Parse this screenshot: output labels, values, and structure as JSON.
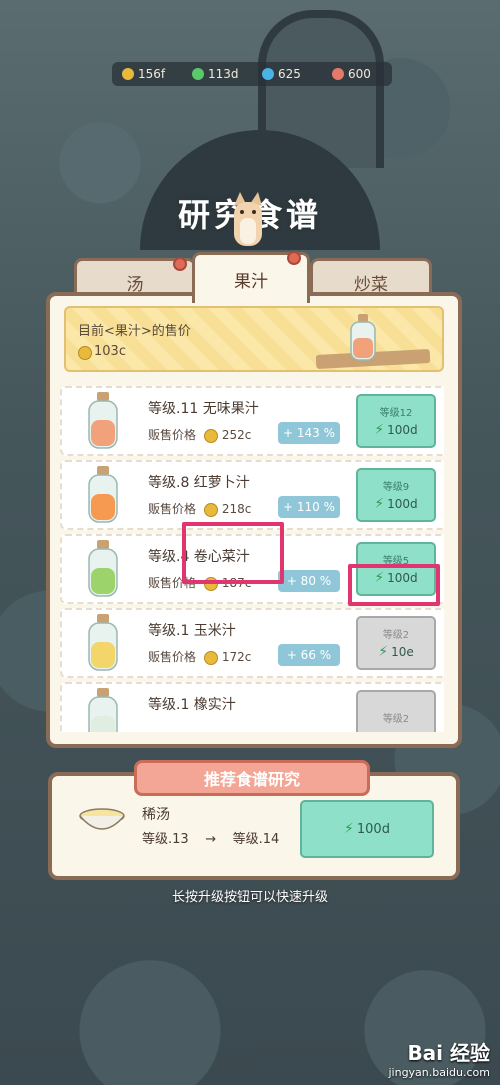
{
  "resources": [
    {
      "icon": "coin-icon",
      "value": "156f",
      "color": "#e8b93a"
    },
    {
      "icon": "energy-icon",
      "value": "113d",
      "color": "#5bc96a"
    },
    {
      "icon": "gem-icon",
      "value": "625",
      "color": "#4ab3e6"
    },
    {
      "icon": "heart-icon",
      "value": "600",
      "color": "#e67a6a"
    }
  ],
  "title": "研究食谱",
  "tabs": [
    {
      "label": "汤"
    },
    {
      "label": "果汁"
    },
    {
      "label": "炒菜"
    }
  ],
  "banner": {
    "label": "目前<果汁>的售价",
    "price": "103c"
  },
  "recipes": [
    {
      "name": "等级.11  无味果汁",
      "sell_label": "贩售价格",
      "sell": "252c",
      "pct": "+ 143 %",
      "next": "等级12",
      "cost": "100d",
      "juice": "#f2a27a",
      "locked": false
    },
    {
      "name": "等级.8  红萝卜汁",
      "sell_label": "贩售价格",
      "sell": "218c",
      "pct": "+ 110 %",
      "next": "等级9",
      "cost": "100d",
      "juice": "#f59a50",
      "locked": false
    },
    {
      "name": "等级.4  卷心菜汁",
      "sell_label": "贩售价格",
      "sell": "187c",
      "pct": "+ 80 %",
      "next": "等级5",
      "cost": "100d",
      "juice": "#9cd36a",
      "locked": false
    },
    {
      "name": "等级.1  玉米汁",
      "sell_label": "贩售价格",
      "sell": "172c",
      "pct": "+ 66 %",
      "next": "等级2",
      "cost": "10e",
      "juice": "#f2d66a",
      "locked": true
    },
    {
      "name": "等级.1  橡实汁",
      "sell_label": "贩售价格",
      "sell": "",
      "pct": "",
      "next": "等级2",
      "cost": "",
      "juice": "#dfeee0",
      "locked": true
    }
  ],
  "recommend": {
    "title": "推荐食谱研究",
    "name": "稀汤",
    "from": "等级.13",
    "arrow": "→",
    "to": "等级.14",
    "cost": "100d"
  },
  "hint": "长按升级按钮可以快速升级",
  "watermark": {
    "brand": "Bai 经验",
    "url": "jingyan.baidu.com"
  }
}
